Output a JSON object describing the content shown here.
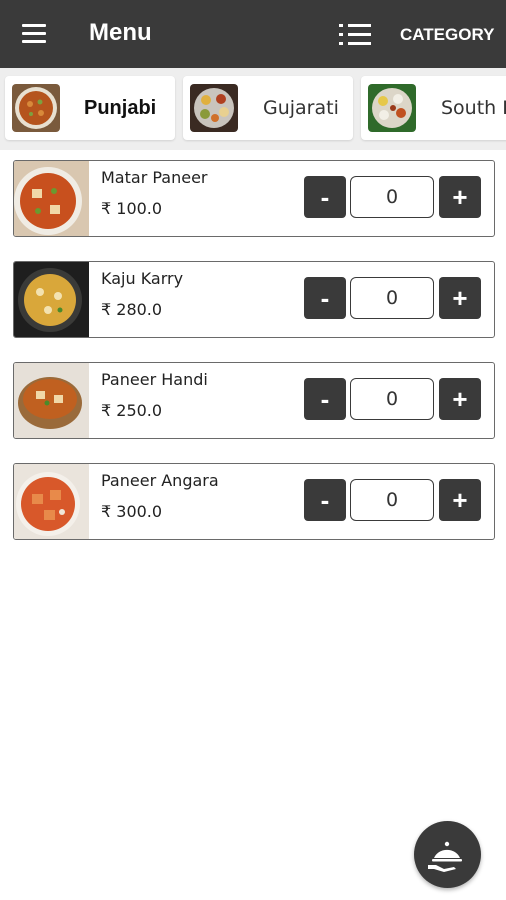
{
  "appbar": {
    "title": "Menu",
    "category_label": "CATEGORY",
    "menu_icon": "hamburger-icon",
    "list_icon": "list-icon"
  },
  "categories": [
    {
      "label": "Punjabi",
      "active": true
    },
    {
      "label": "Gujarati",
      "active": false
    },
    {
      "label": "South In",
      "active": false
    }
  ],
  "items": [
    {
      "name": "Matar Paneer",
      "price": "₹ 100.0",
      "qty": "0",
      "minus": "-",
      "plus": "+"
    },
    {
      "name": "Kaju Karry",
      "price": "₹ 280.0",
      "qty": "0",
      "minus": "-",
      "plus": "+"
    },
    {
      "name": "Paneer Handi",
      "price": "₹ 250.0",
      "qty": "0",
      "minus": "-",
      "plus": "+"
    },
    {
      "name": "Paneer Angara",
      "price": "₹ 300.0",
      "qty": "0",
      "minus": "-",
      "plus": "+"
    }
  ],
  "fab": {
    "icon": "serving-cloche-icon"
  },
  "colors": {
    "appbar": "#3a3a3a",
    "button": "#3a3a3a",
    "tab_strip": "#eeeeee"
  }
}
